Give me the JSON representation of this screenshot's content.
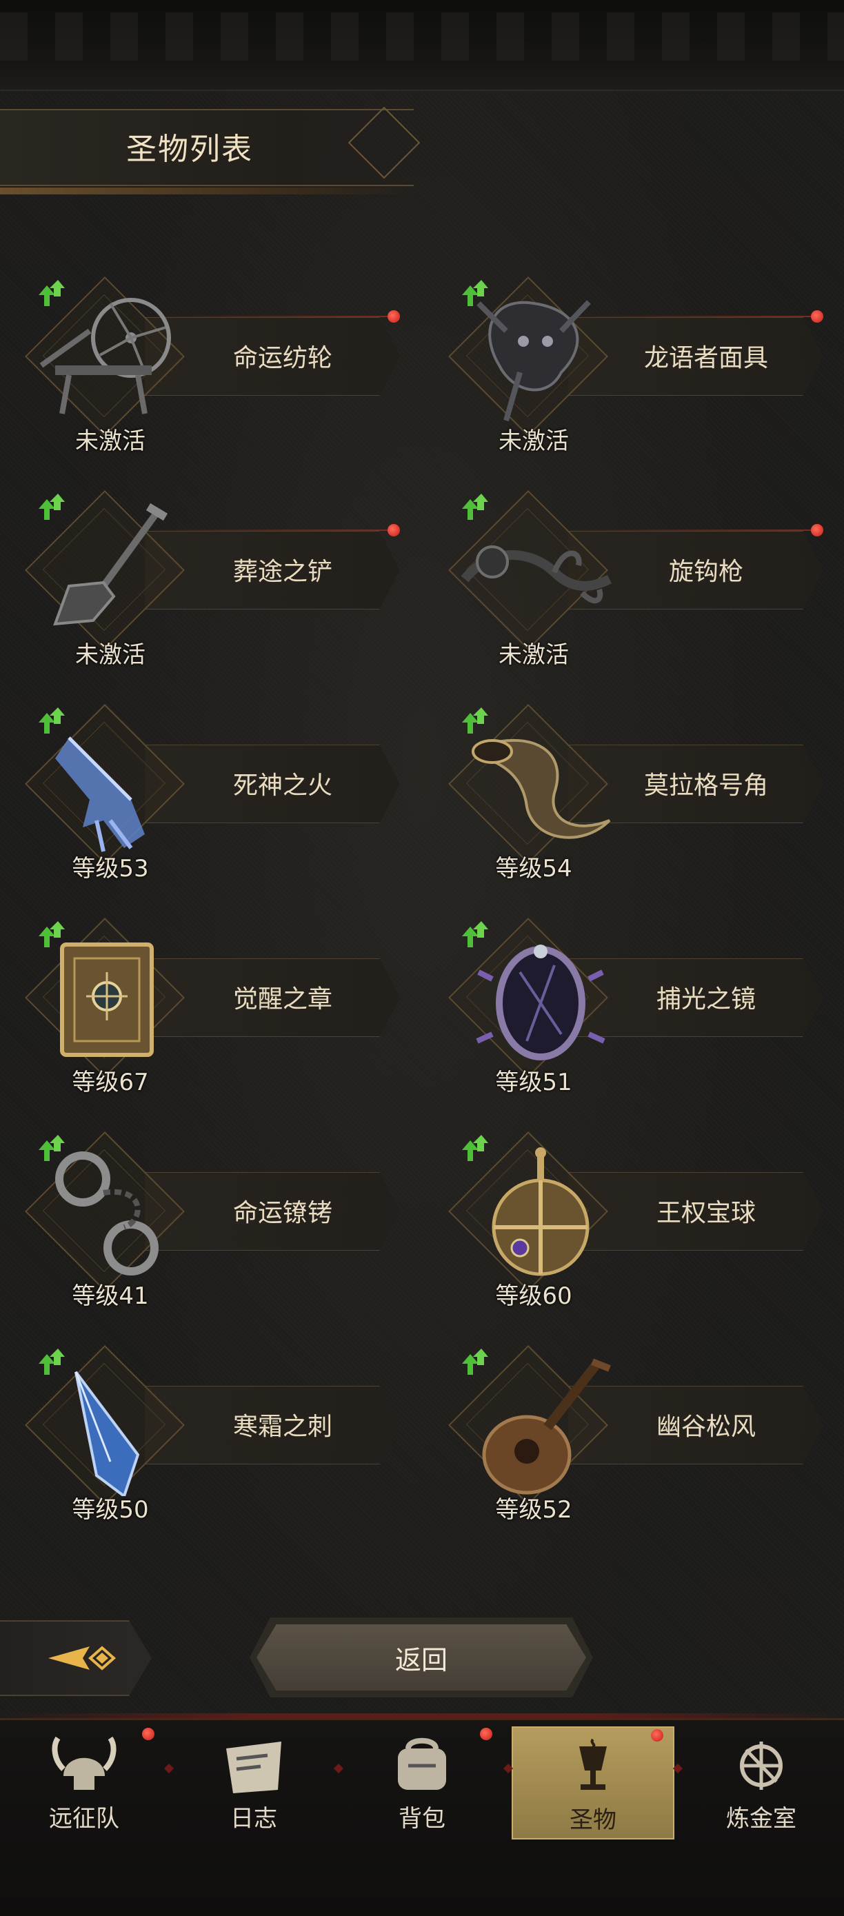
{
  "header": {
    "title": "圣物列表"
  },
  "relics": [
    {
      "name": "命运纺轮",
      "status": "未激活",
      "has_red_dot": true,
      "art_icon": "spinning-wheel-icon"
    },
    {
      "name": "龙语者面具",
      "status": "未激活",
      "has_red_dot": true,
      "art_icon": "dragon-mask-icon"
    },
    {
      "name": "葬途之铲",
      "status": "未激活",
      "has_red_dot": true,
      "art_icon": "shovel-icon"
    },
    {
      "name": "旋钩枪",
      "status": "未激活",
      "has_red_dot": true,
      "art_icon": "hook-spear-icon"
    },
    {
      "name": "死神之火",
      "status": "等级53",
      "has_red_dot": false,
      "art_icon": "spectral-hand-icon"
    },
    {
      "name": "莫拉格号角",
      "status": "等级54",
      "has_red_dot": false,
      "art_icon": "war-horn-icon"
    },
    {
      "name": "觉醒之章",
      "status": "等级67",
      "has_red_dot": false,
      "art_icon": "tome-icon"
    },
    {
      "name": "捕光之镜",
      "status": "等级51",
      "has_red_dot": false,
      "art_icon": "mirror-icon"
    },
    {
      "name": "命运镣铐",
      "status": "等级41",
      "has_red_dot": false,
      "art_icon": "shackles-icon"
    },
    {
      "name": "王权宝球",
      "status": "等级60",
      "has_red_dot": false,
      "art_icon": "royal-orb-icon"
    },
    {
      "name": "寒霜之刺",
      "status": "等级50",
      "has_red_dot": false,
      "art_icon": "ice-shard-icon"
    },
    {
      "name": "幽谷松风",
      "status": "等级52",
      "has_red_dot": false,
      "art_icon": "lute-icon"
    }
  ],
  "controls": {
    "back_label": "返回"
  },
  "nav": {
    "tabs": [
      {
        "label": "远征队",
        "icon": "viking-helmet-icon",
        "active": false,
        "has_red_dot": true
      },
      {
        "label": "日志",
        "icon": "scroll-map-icon",
        "active": false,
        "has_red_dot": false
      },
      {
        "label": "背包",
        "icon": "backpack-scroll-icon",
        "active": false,
        "has_red_dot": true
      },
      {
        "label": "圣物",
        "icon": "chalice-icon",
        "active": true,
        "has_red_dot": true
      },
      {
        "label": "炼金室",
        "icon": "alchemy-icon",
        "active": false,
        "has_red_dot": false
      }
    ]
  },
  "colors": {
    "accent_gold": "#b59c5e",
    "upgrade_green": "#4fbf3a",
    "notify_red": "#d8241a"
  }
}
